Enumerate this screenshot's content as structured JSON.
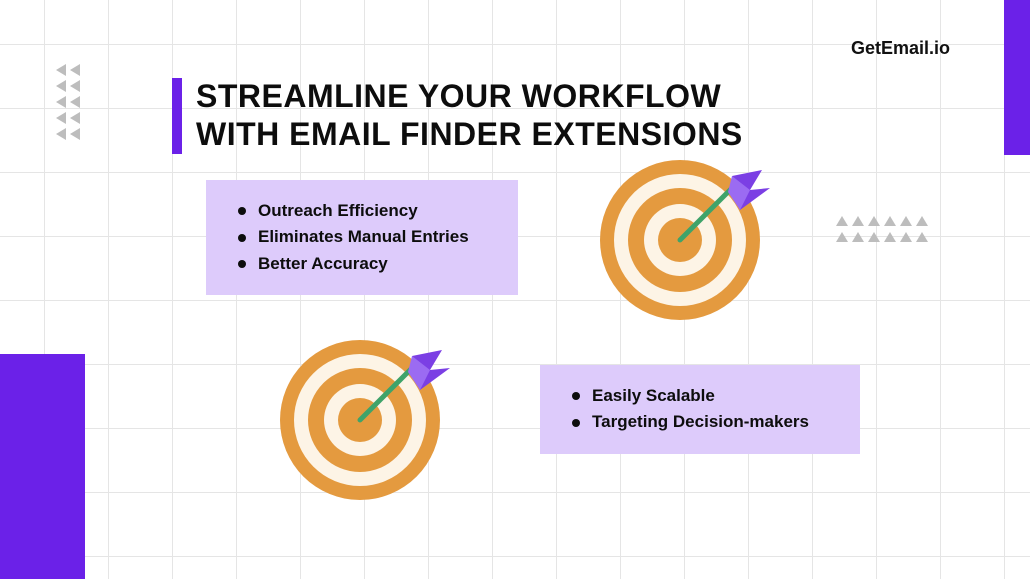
{
  "brand": "GetEmail.io",
  "heading_line1": "STREAMLINE YOUR WORKFLOW",
  "heading_line2": "WITH EMAIL FINDER EXTENSIONS",
  "card_a": {
    "items": [
      "Outreach Efficiency",
      "Eliminates Manual Entries",
      "Better Accuracy"
    ]
  },
  "card_b": {
    "items": [
      "Easily Scalable",
      "Targeting Decision-makers"
    ]
  },
  "colors": {
    "accent": "#6b21e8",
    "card_bg": "#ddcbfb",
    "target_orange": "#e49a3f",
    "target_cream": "#fdf4e6",
    "dart_purple": "#7b3fe4",
    "dart_shaft": "#3fa36a"
  }
}
